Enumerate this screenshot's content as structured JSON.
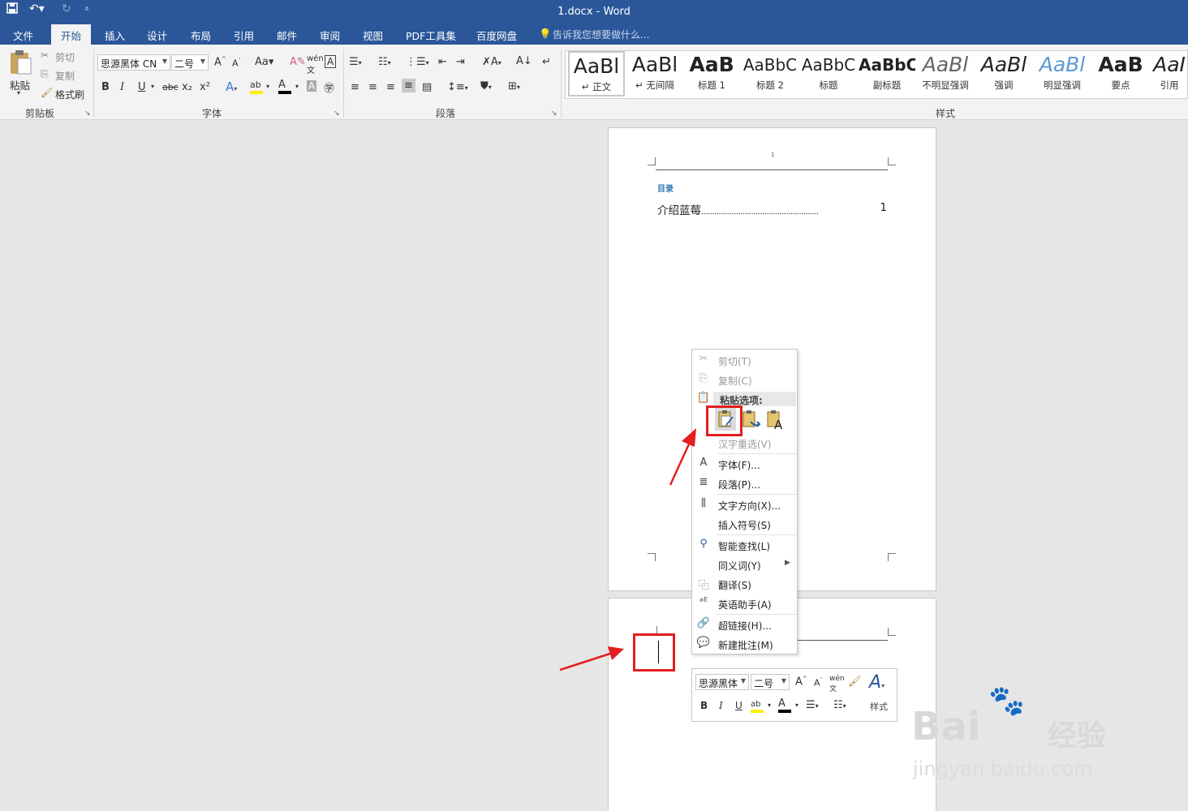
{
  "titlebar": {
    "title": "1.docx - Word",
    "save_icon": "save-icon",
    "undo_icon": "undo-icon",
    "redo_icon": "redo-icon"
  },
  "tabs": [
    {
      "label": "文件"
    },
    {
      "label": "开始"
    },
    {
      "label": "插入"
    },
    {
      "label": "设计"
    },
    {
      "label": "布局"
    },
    {
      "label": "引用"
    },
    {
      "label": "邮件"
    },
    {
      "label": "审阅"
    },
    {
      "label": "视图"
    },
    {
      "label": "PDF工具集"
    },
    {
      "label": "百度网盘"
    }
  ],
  "tell_me": "告诉我您想要做什么...",
  "clipboard": {
    "paste": "粘贴",
    "cut": "剪切",
    "copy": "复制",
    "format_painter": "格式刷",
    "group": "剪贴板"
  },
  "font": {
    "name": "思源黑体 CN",
    "size": "二号",
    "group": "字体",
    "bold": "B",
    "italic": "I",
    "underline": "U",
    "strike": "abc",
    "sub": "x₂",
    "sup": "x²"
  },
  "paragraph": {
    "group": "段落"
  },
  "styles": {
    "group": "样式",
    "items": [
      {
        "preview": "AaBl",
        "name": "↵ 正文"
      },
      {
        "preview": "AaBl",
        "name": "↵ 无间隔"
      },
      {
        "preview": "AaB",
        "name": "标题 1"
      },
      {
        "preview": "AaBbC",
        "name": "标题 2"
      },
      {
        "preview": "AaBbC",
        "name": "标题"
      },
      {
        "preview": "AaBbC",
        "name": "副标题"
      },
      {
        "preview": "AaBl",
        "name": "不明显强调"
      },
      {
        "preview": "AaBl",
        "name": "强调"
      },
      {
        "preview": "AaBl",
        "name": "明显强调"
      },
      {
        "preview": "AaB",
        "name": "要点"
      },
      {
        "preview": "AaI",
        "name": "引用"
      }
    ]
  },
  "page1": {
    "header_num": "1",
    "toc_heading": "目录",
    "toc_entry": "介绍蓝莓",
    "toc_dots": "......................................................",
    "toc_page": "1"
  },
  "context_menu": {
    "cut": "剪切(T)",
    "copy": "复制(C)",
    "paste_options": "粘贴选项:",
    "reconvert": "汉字重选(V)",
    "font": "字体(F)...",
    "paragraph": "段落(P)...",
    "text_direction": "文字方向(X)...",
    "insert_symbol": "插入符号(S)",
    "smart_lookup": "智能查找(L)",
    "synonyms": "同义词(Y)",
    "translate": "翻译(S)",
    "english_helper": "英语助手(A)",
    "hyperlink": "超链接(H)...",
    "new_comment": "新建批注(M)"
  },
  "mini_toolbar": {
    "font": "思源黑体",
    "size": "二号",
    "styles": "样式",
    "bold": "B",
    "italic": "I",
    "underline": "U"
  },
  "watermark": {
    "brand": "Bai",
    "brand2": "经验",
    "url": "jingyan.baidu.com"
  },
  "colors": {
    "word_blue": "#2b579a",
    "annotation_red": "#e41e1e"
  }
}
